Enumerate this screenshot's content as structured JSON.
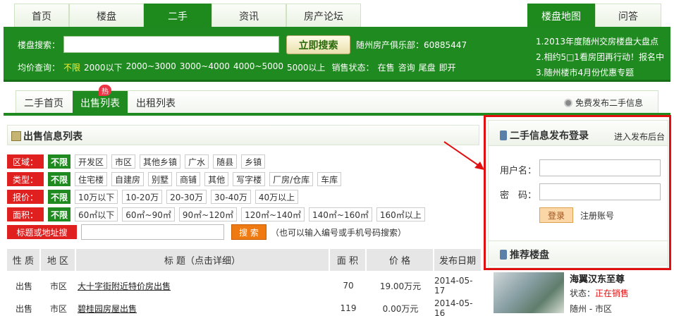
{
  "top_tabs": [
    "首页",
    "楼盘",
    "二手",
    "资讯",
    "房产论坛"
  ],
  "right_tabs": [
    "楼盘地图",
    "问答"
  ],
  "search": {
    "label": "楼盘搜索：",
    "button": "立即搜索",
    "club": "随州房产俱乐部：60885447"
  },
  "price_filter": {
    "label": "均价查询：",
    "options": [
      "不限",
      "2000以下",
      "2000~3000",
      "3000~4000",
      "4000~5000",
      "5000以上"
    ],
    "sales_label": "销售状态：",
    "sales_options": [
      "在售",
      "咨询",
      "尾盘",
      "即开"
    ]
  },
  "promos": [
    "1.2013年度随州交房楼盘大盘点",
    "2.相约5□1看房团再行动！报名中",
    "3.随州楼市4月份优惠专题"
  ],
  "subnav": {
    "tabs": [
      "二手首页",
      "出售列表",
      "出租列表"
    ],
    "hot_badge": "热",
    "free_post": "免费发布二手信息"
  },
  "list": {
    "title": "出售信息列表",
    "none_label": "不限",
    "filters": [
      {
        "label": "区域：",
        "options": [
          "开发区",
          "市区",
          "其他乡镇",
          "广水",
          "随县",
          "乡镇"
        ]
      },
      {
        "label": "类型：",
        "options": [
          "住宅楼",
          "自建房",
          "别墅",
          "商铺",
          "其他",
          "写字楼",
          "厂房/仓库",
          "车库"
        ]
      },
      {
        "label": "报价：",
        "options": [
          "10万以下",
          "10-20万",
          "20-30万",
          "30-40万",
          "40万以上"
        ]
      },
      {
        "label": "面积：",
        "options": [
          "60㎡以下",
          "60㎡~90㎡",
          "90㎡~120㎡",
          "120㎡~140㎡",
          "140㎡~160㎡",
          "160㎡以上"
        ]
      }
    ],
    "keyword_label": "标题或地址搜",
    "keyword_button": "搜 索",
    "keyword_hint": "（也可以输入编号或手机号码搜索）",
    "columns": [
      "性 质",
      "地 区",
      "标 题（点击详细）",
      "面 积",
      "价 格",
      "发布日期"
    ],
    "rows": [
      {
        "type": "出售",
        "area": "市区",
        "title": "大十字街附近特价房出售",
        "size": "70",
        "price": "19.00万元",
        "date": "2014-05-17"
      },
      {
        "type": "出售",
        "area": "市区",
        "title": "碧桂园房屋出售",
        "size": "119",
        "price": "0.00万元",
        "date": "2014-05-16"
      }
    ]
  },
  "login": {
    "title": "二手信息发布登录",
    "admin_link": "进入发布后台",
    "username_label": "用户名：",
    "password_label": "密　码：",
    "login_button": "登录",
    "register_link": "注册账号"
  },
  "recommend": {
    "title": "推荐楼盘",
    "name": "海翼汉东至尊",
    "status_label": "状态：",
    "status_value": "正在销售",
    "area": "随州 - 市区"
  }
}
